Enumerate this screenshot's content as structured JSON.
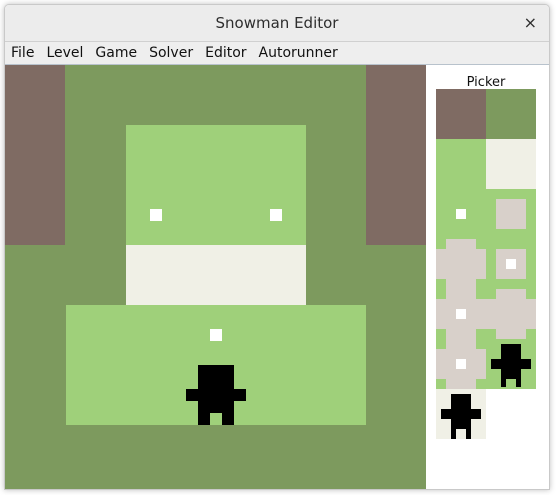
{
  "window": {
    "title": "Snowman Editor",
    "close_glyph": "×"
  },
  "menu": [
    "File",
    "Level",
    "Game",
    "Solver",
    "Editor",
    "Autorunner"
  ],
  "picker": {
    "title": "Picker",
    "tiles": [
      "wall",
      "grass",
      "snow",
      "grass-snow",
      "grass-small-snowball",
      "grass-large-snowball",
      "grass-large-small-snowball",
      "grass-medium-snowball",
      "grass-large-medium-snowball",
      "grass-player",
      "grass-medium-small-snowball",
      "grass-player-alt",
      "snow-player"
    ]
  },
  "colors": {
    "grass": "#7d9a5e",
    "snow_ground": "#9fd07a",
    "snow_pile": "#f0f0e6",
    "wall": "#7f6b63",
    "snowball": "#d8d0ca",
    "player": "#000000",
    "dot": "#ffffff"
  }
}
